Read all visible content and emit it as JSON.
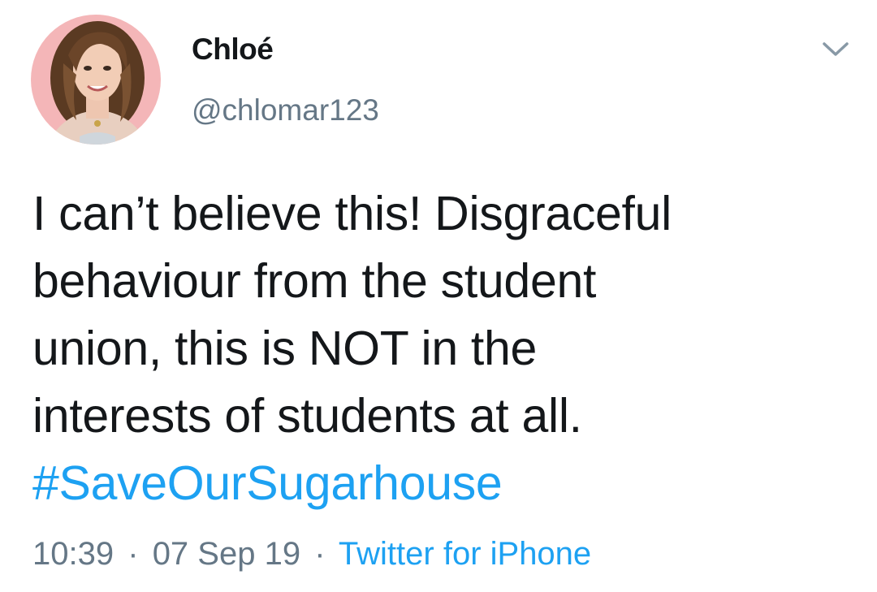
{
  "author": {
    "display_name": "Chloé",
    "handle": "@chlomar123",
    "avatar_icon": "profile-photo-avatar",
    "avatar_bg": "#f4b6b8"
  },
  "menu": {
    "icon": "chevron-down-icon"
  },
  "tweet": {
    "lines": [
      "I can’t believe this! Disgraceful",
      "behaviour from the student",
      "union, this is NOT in the",
      "interests of students at all."
    ],
    "hashtag": "#SaveOurSugarhouse"
  },
  "meta": {
    "time": "10:39",
    "separator": "·",
    "date": "07 Sep 19",
    "source": "Twitter for iPhone"
  },
  "colors": {
    "text": "#14171a",
    "secondary": "#657786",
    "link": "#1da1f2"
  }
}
